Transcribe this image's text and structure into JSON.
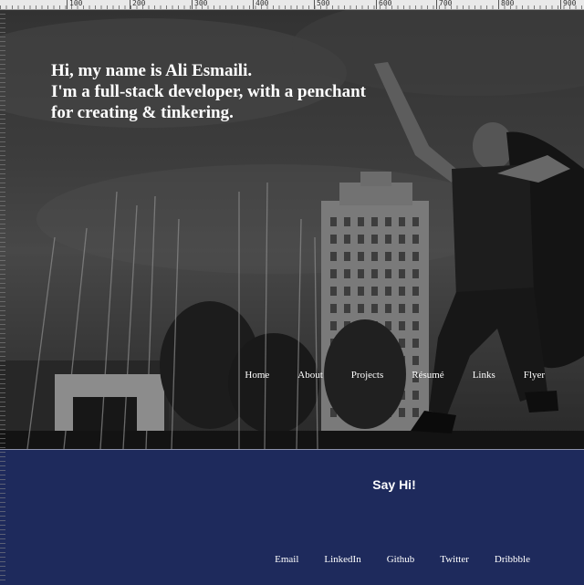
{
  "hero": {
    "headline": [
      "Hi, my name is Ali Esmaili.",
      "I'm a full-stack developer, with a penchant",
      "for creating & tinkering."
    ]
  },
  "nav": {
    "items": [
      "Home",
      "About",
      "Projects",
      "Résumé",
      "Links",
      "Flyer"
    ]
  },
  "footer": {
    "heading": "Say Hi!",
    "links": [
      "Email",
      "LinkedIn",
      "Github",
      "Twitter",
      "Dribbble"
    ]
  },
  "ruler": {
    "labels": [
      "100",
      "200",
      "300",
      "400",
      "500",
      "600",
      "700",
      "800",
      "900"
    ]
  },
  "colors": {
    "footer_bg": "#1e2a5c",
    "text": "#ffffff"
  }
}
